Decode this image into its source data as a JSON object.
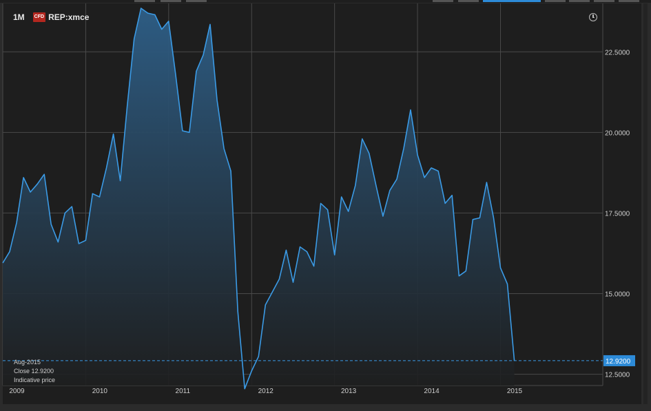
{
  "header": {
    "interval": "1M",
    "badge": "CFD",
    "symbol": "REP:xmce"
  },
  "info": {
    "date": "Aug-2015",
    "close_label": "Close",
    "close_value": "12.9200",
    "note": "Indicative price"
  },
  "last_price_label": "12.9200",
  "icons": {
    "clock": "clock-icon"
  },
  "colors": {
    "line": "#3b9be6",
    "last_price_tag": "#2d8bd8",
    "background": "#1e1e1e",
    "grid": "#4a4a4a"
  },
  "chart_data": {
    "type": "area",
    "x_ticks": [
      "2009",
      "2010",
      "2011",
      "2012",
      "2013",
      "2014",
      "2015"
    ],
    "y_ticks": [
      "12.5000",
      "15.0000",
      "17.5000",
      "20.0000",
      "22.5000"
    ],
    "ylim": [
      12.15,
      24.0
    ],
    "grid": true,
    "series": [
      {
        "values": [
          {
            "x": "2008-10",
            "y": 15.95
          },
          {
            "x": "2008-11",
            "y": 16.3
          },
          {
            "x": "2008-12",
            "y": 17.2
          },
          {
            "x": "2009-01",
            "y": 18.6
          },
          {
            "x": "2009-02",
            "y": 18.15
          },
          {
            "x": "2009-03",
            "y": 18.4
          },
          {
            "x": "2009-04",
            "y": 18.7
          },
          {
            "x": "2009-05",
            "y": 17.15
          },
          {
            "x": "2009-06",
            "y": 16.6
          },
          {
            "x": "2009-07",
            "y": 17.5
          },
          {
            "x": "2009-08",
            "y": 17.7
          },
          {
            "x": "2009-09",
            "y": 16.55
          },
          {
            "x": "2009-10",
            "y": 16.65
          },
          {
            "x": "2009-11",
            "y": 18.1
          },
          {
            "x": "2009-12",
            "y": 18.0
          },
          {
            "x": "2010-01",
            "y": 18.9
          },
          {
            "x": "2010-02",
            "y": 19.95
          },
          {
            "x": "2010-03",
            "y": 18.5
          },
          {
            "x": "2010-04",
            "y": 20.8
          },
          {
            "x": "2010-05",
            "y": 22.9
          },
          {
            "x": "2010-06",
            "y": 23.85
          },
          {
            "x": "2010-07",
            "y": 23.7
          },
          {
            "x": "2010-08",
            "y": 23.65
          },
          {
            "x": "2010-09",
            "y": 23.2
          },
          {
            "x": "2010-10",
            "y": 23.45
          },
          {
            "x": "2010-11",
            "y": 21.8
          },
          {
            "x": "2010-12",
            "y": 20.05
          },
          {
            "x": "2011-01",
            "y": 20.0
          },
          {
            "x": "2011-02",
            "y": 21.9
          },
          {
            "x": "2011-03",
            "y": 22.4
          },
          {
            "x": "2011-04",
            "y": 23.35
          },
          {
            "x": "2011-05",
            "y": 21.0
          },
          {
            "x": "2011-06",
            "y": 19.5
          },
          {
            "x": "2011-07",
            "y": 18.8
          },
          {
            "x": "2011-08",
            "y": 14.45
          },
          {
            "x": "2011-09",
            "y": 12.05
          },
          {
            "x": "2011-10",
            "y": 12.6
          },
          {
            "x": "2011-11",
            "y": 13.05
          },
          {
            "x": "2011-12",
            "y": 14.65
          },
          {
            "x": "2012-01",
            "y": 15.05
          },
          {
            "x": "2012-02",
            "y": 15.45
          },
          {
            "x": "2012-03",
            "y": 16.35
          },
          {
            "x": "2012-04",
            "y": 15.35
          },
          {
            "x": "2012-05",
            "y": 16.45
          },
          {
            "x": "2012-06",
            "y": 16.3
          },
          {
            "x": "2012-07",
            "y": 15.85
          },
          {
            "x": "2012-08",
            "y": 17.8
          },
          {
            "x": "2012-09",
            "y": 17.6
          },
          {
            "x": "2012-10",
            "y": 16.2
          },
          {
            "x": "2012-11",
            "y": 18.0
          },
          {
            "x": "2012-12",
            "y": 17.55
          },
          {
            "x": "2013-01",
            "y": 18.35
          },
          {
            "x": "2013-02",
            "y": 19.8
          },
          {
            "x": "2013-03",
            "y": 19.35
          },
          {
            "x": "2013-04",
            "y": 18.35
          },
          {
            "x": "2013-05",
            "y": 17.4
          },
          {
            "x": "2013-06",
            "y": 18.2
          },
          {
            "x": "2013-07",
            "y": 18.55
          },
          {
            "x": "2013-08",
            "y": 19.5
          },
          {
            "x": "2013-09",
            "y": 20.7
          },
          {
            "x": "2013-10",
            "y": 19.3
          },
          {
            "x": "2013-11",
            "y": 18.6
          },
          {
            "x": "2013-12",
            "y": 18.9
          },
          {
            "x": "2014-01",
            "y": 18.8
          },
          {
            "x": "2014-02",
            "y": 17.8
          },
          {
            "x": "2014-03",
            "y": 18.05
          },
          {
            "x": "2014-04",
            "y": 15.55
          },
          {
            "x": "2014-05",
            "y": 15.7
          },
          {
            "x": "2014-06",
            "y": 17.3
          },
          {
            "x": "2014-07",
            "y": 17.35
          },
          {
            "x": "2014-08",
            "y": 18.45
          },
          {
            "x": "2014-09",
            "y": 17.35
          },
          {
            "x": "2014-10",
            "y": 15.8
          },
          {
            "x": "2014-11",
            "y": 15.3
          },
          {
            "x": "2014-12",
            "y": 12.92
          }
        ]
      }
    ],
    "last_value": 12.92
  }
}
